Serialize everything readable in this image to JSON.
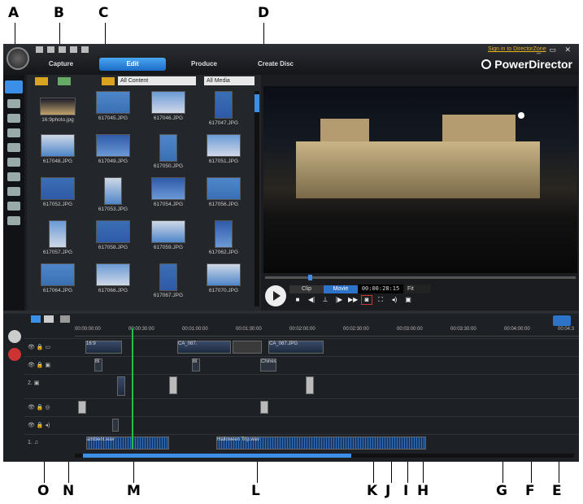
{
  "callouts": {
    "top": [
      "A",
      "B",
      "C",
      "D"
    ],
    "bottom": [
      "O",
      "N",
      "M",
      "L",
      "K",
      "J",
      "I",
      "H",
      "G",
      "F",
      "E"
    ]
  },
  "titlebar": {
    "signin": "Sign in to DirectorZone",
    "window_controls": "_ ▭ ✕",
    "brand": "PowerDirector"
  },
  "tabs": [
    "Capture",
    "Edit",
    "Produce",
    "Create Disc"
  ],
  "active_tab": "Edit",
  "library": {
    "filter": "All Content",
    "media": "All Media",
    "items": [
      "16:9photo.jpg",
      "617045.JPG",
      "617046.JPG",
      "617047.JPG",
      "617048.JPG",
      "617049.JPG",
      "617050.JPG",
      "617051.JPG",
      "617052.JPG",
      "617053.JPG",
      "617054.JPG",
      "617056.JPG",
      "617057.JPG",
      "617058.JPG",
      "617059.JPG",
      "617062.JPG",
      "617064.JPG",
      "617066.JPG",
      "617067.JPG",
      "617070.JPG"
    ]
  },
  "preview": {
    "modes": [
      "Clip",
      "Movie"
    ],
    "active_mode": "Movie",
    "timecode": "00:00:28:15",
    "fit": "Fit",
    "seek_position_fraction": 0.14
  },
  "timeline": {
    "ruler": [
      "00:00:00:00",
      "00:00:30:00",
      "00:01:00:00",
      "00:01:30:00",
      "00:02:00:00",
      "00:02:30:00",
      "00:03:00:00",
      "00:03:30:00",
      "00:04:00:00",
      "00:04:3"
    ],
    "video_clips": [
      "16:9",
      "CA_087.",
      "CA_087.JPG"
    ],
    "fx_labels": [
      "Bl",
      "Bl",
      "Chines"
    ],
    "track_numbers": [
      "2.",
      "1."
    ],
    "audio_clips": [
      "ambient.wav",
      "Halloween Trip.wav"
    ]
  },
  "colors": {
    "accent": "#3c8fe6",
    "playhead": "#1ec04a",
    "signin": "#e6b422"
  }
}
